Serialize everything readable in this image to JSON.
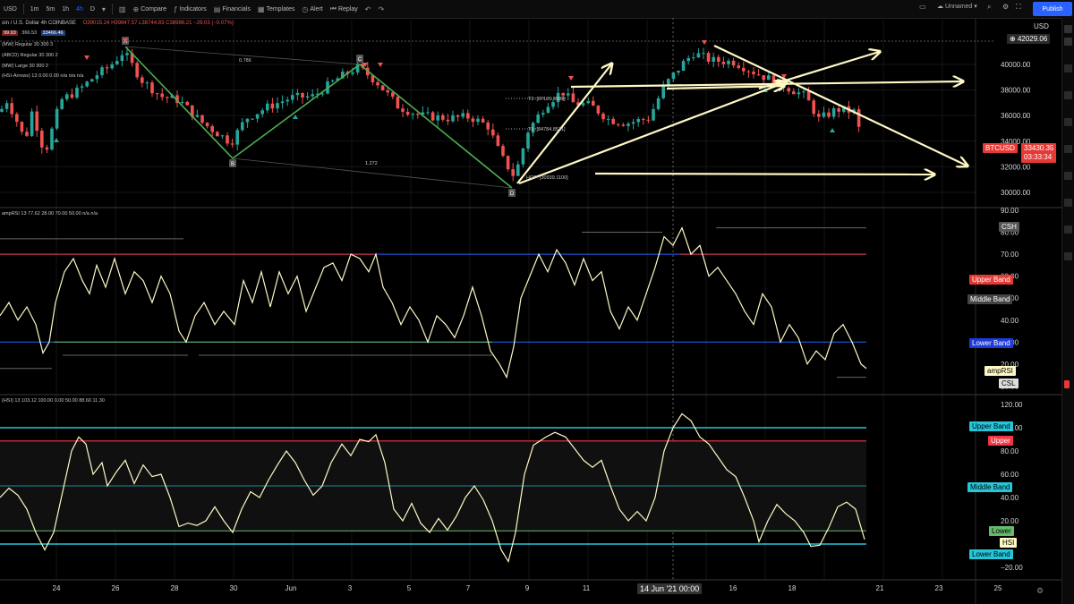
{
  "toolbar": {
    "symbol_prefix": "USD",
    "intervals": [
      "1m",
      "5m",
      "1h",
      "4h",
      "D"
    ],
    "active_interval": "4h",
    "compare_label": "Compare",
    "indicators_label": "Indicators",
    "financials_label": "Financials",
    "templates_label": "Templates",
    "alert_label": "Alert",
    "replay_label": "Replay",
    "layout_label": "Unnamed",
    "publish_label": "Publish"
  },
  "legend": {
    "title": "oin / U.S. Dollar  4h  COINBASE",
    "ohlc": "O39015.24 H39847.57 L38744.83 C38986.21 −29.03 (−0.07%)",
    "bid": "99.93",
    "spread": "366.53",
    "ask": "33466.46",
    "indicators": [
      "(MW) Regular 30 300 3",
      "(ABCD) Regular 30 300 2",
      "(MW) Large 30 300 2",
      "(HSI-Arrows) 13  0.00  0.00  n/a  n/a  n/a"
    ]
  },
  "price_axis": {
    "unit": "USD",
    "ticks": [
      "40000.00",
      "38000.00",
      "36000.00",
      "34000.00",
      "32000.00",
      "30000.00"
    ],
    "high_label": "42029.06",
    "symbol_label": "BTCUSD",
    "last_price": "33430.35",
    "countdown": "03:33:34"
  },
  "pattern": {
    "points": [
      "A",
      "B",
      "C",
      "D"
    ],
    "ratio_top": "0.786",
    "ratio_bottom": "1.272",
    "t1": "T1: [34784.8531]",
    "t2": "T2: [37120.0909]",
    "hop": "HOP: [30939.1100]"
  },
  "amprsi": {
    "legend": "ampRSI  13  77.62  28.00  70.00  50.00  n/a  n/a",
    "ticks": [
      "90.00",
      "80.00",
      "70.00",
      "60.00",
      "50.00",
      "40.00",
      "30.00",
      "20.00",
      "10.00"
    ],
    "csh": "CSH",
    "upper_band": "Upper Band",
    "middle_band": "Middle Band",
    "lower_band": "Lower Band",
    "name": "ampRSI",
    "csl": "CSL"
  },
  "hsi": {
    "legend": "(HSI)  13  103.12  100.00  0.00  50.00  88.60  11.30",
    "ticks": [
      "120.00",
      "100.00",
      "80.00",
      "60.00",
      "40.00",
      "20.00",
      "0.00",
      "−20.00"
    ],
    "upper_band": "Upper Band",
    "upper": "Upper",
    "middle_band": "Middle Band",
    "lower": "Lower",
    "name": "HSI",
    "lower_band": "Lower Band"
  },
  "time_axis": {
    "labels": [
      "24",
      "26",
      "28",
      "30",
      "Jun",
      "3",
      "5",
      "7",
      "9",
      "11",
      "16",
      "18",
      "21",
      "23",
      "25"
    ],
    "crosshair": "14 Jun '21   00:00"
  },
  "colors": {
    "up": "#26a69a",
    "down": "#ef5350",
    "pattern": "#4caf50",
    "arrows": "#fff8c4",
    "blue_band": "#2962ff",
    "red_band": "#f23645",
    "cyan_band": "#26c6da",
    "green_band": "#66bb6a"
  }
}
